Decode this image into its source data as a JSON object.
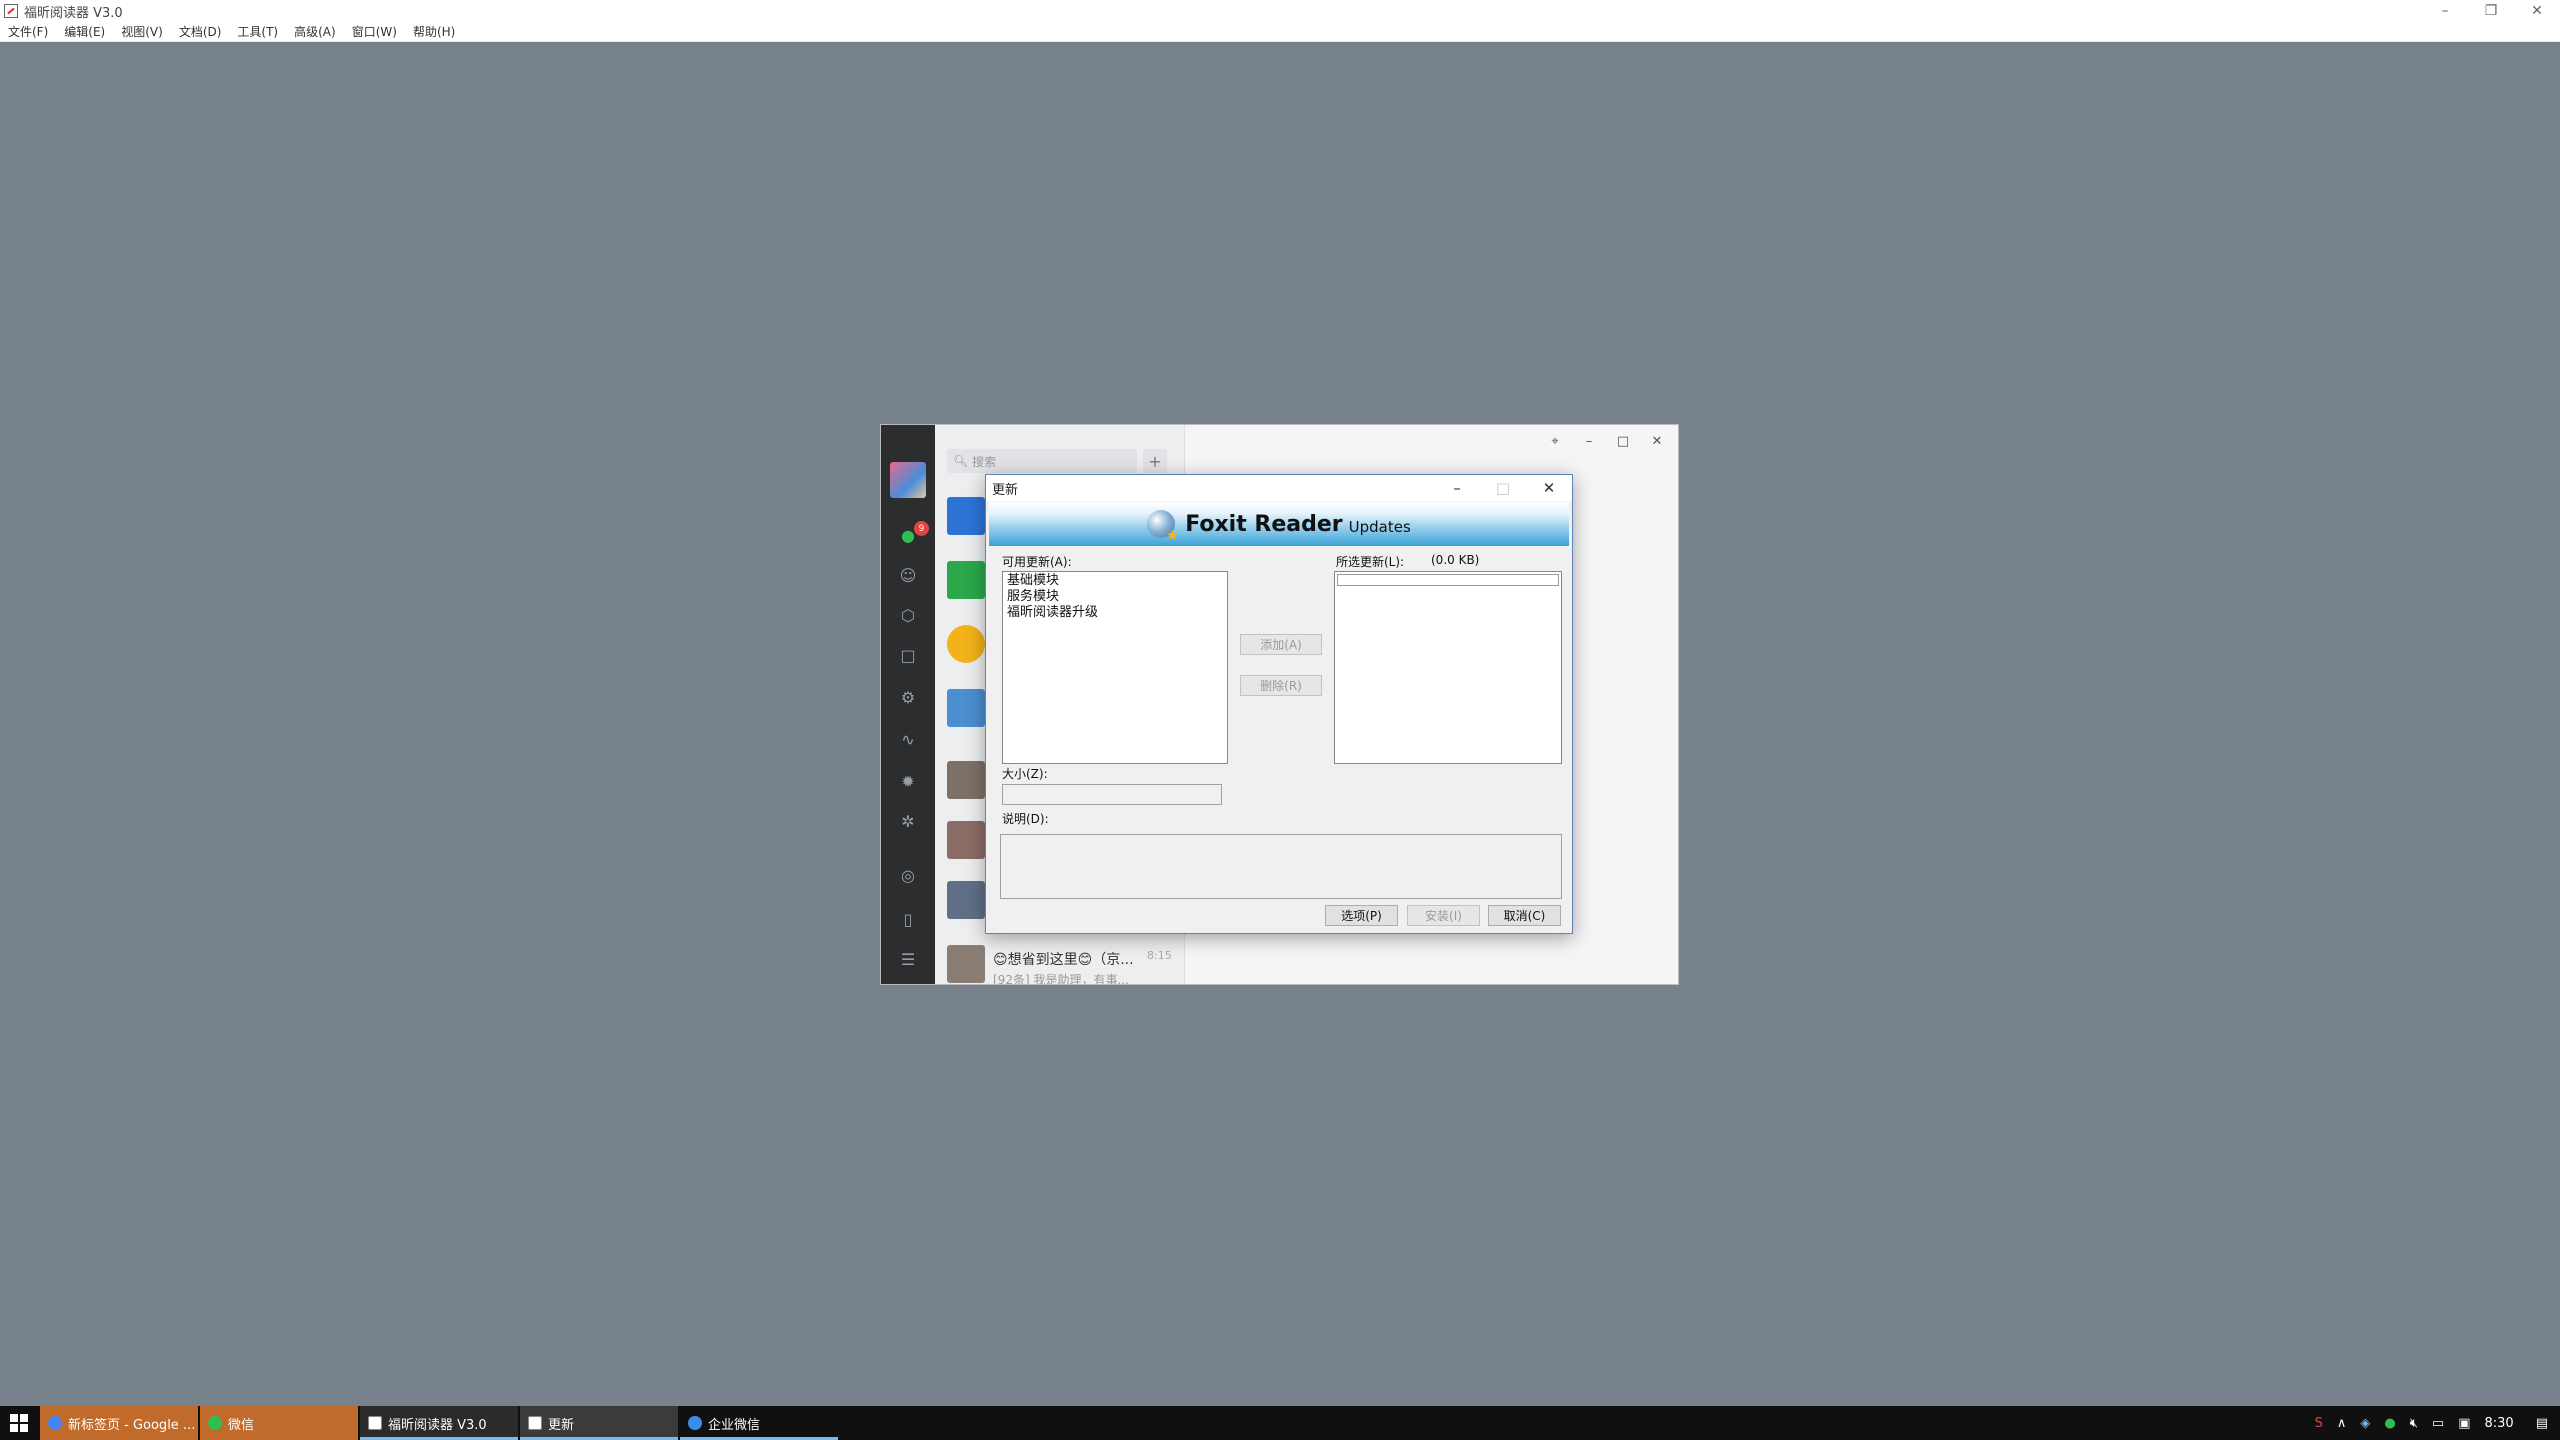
{
  "app": {
    "title": "福昕阅读器 V3.0",
    "menu": [
      "文件(F)",
      "编辑(E)",
      "视图(V)",
      "文档(D)",
      "工具(T)",
      "高级(A)",
      "窗口(W)",
      "帮助(H)"
    ]
  },
  "wecom": {
    "search_placeholder": "搜索",
    "plus_label": "+",
    "badge_count": "9",
    "chat": {
      "name": "😊想省到这里😊（京...",
      "time": "8:15",
      "preview": "[92条] 我是助理，有事..."
    }
  },
  "dialog": {
    "title": "更新",
    "banner_brand": "Foxit Reader",
    "banner_sub": "Updates",
    "available_label": "可用更新(A):",
    "available_items": [
      "基础模块",
      "服务模块",
      "福昕阅读器升级"
    ],
    "selected_label": "所选更新(L):",
    "selected_size": "(0.0 KB)",
    "add_button": "添加(A)",
    "remove_button": "删除(R)",
    "size_label": "大小(Z):",
    "desc_label": "说明(D):",
    "options_button": "选项(P)",
    "install_button": "安装(I)",
    "cancel_button": "取消(C)"
  },
  "taskbar": {
    "tasks": [
      {
        "label": "新标签页 - Google ...",
        "color": "#c06a2b"
      },
      {
        "label": "微信",
        "color": "#c06a2b"
      },
      {
        "label": "福昕阅读器 V3.0",
        "color": "#2b2b2b"
      },
      {
        "label": "更新",
        "color": "#3b3b3b"
      },
      {
        "label": "企业微信",
        "color": "#101010"
      }
    ],
    "time": "8:30"
  }
}
